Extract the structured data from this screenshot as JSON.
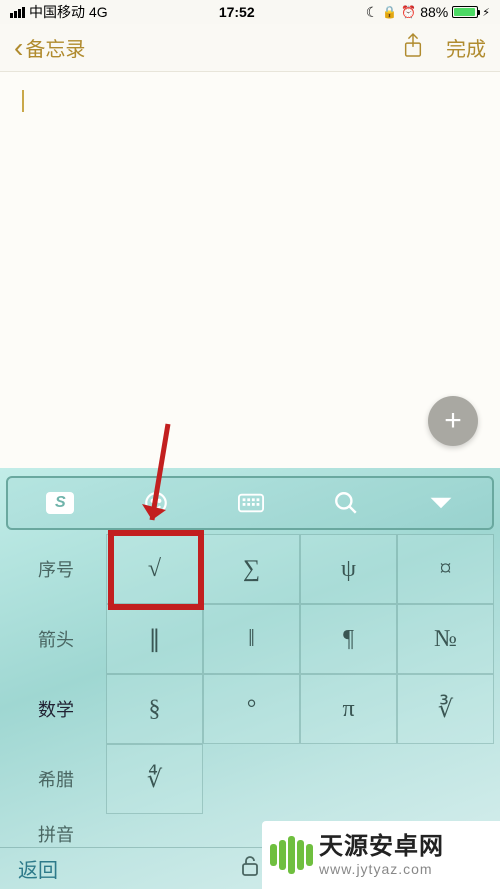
{
  "status": {
    "carrier": "中国移动",
    "network": "4G",
    "time": "17:52",
    "moon": "☾",
    "orientation_lock": "⟳",
    "alarm": "⏰",
    "battery_pct": "88%",
    "charging": "⚡︎"
  },
  "nav": {
    "back_label": "备忘录",
    "done_label": "完成"
  },
  "fab_label": "+",
  "keyboard": {
    "toolbar": {
      "logo": "S"
    },
    "categories": [
      "序号",
      "箭头",
      "数学",
      "希腊",
      "拼音"
    ],
    "grid": [
      [
        "√",
        "∑",
        "ψ",
        "¤"
      ],
      [
        "∥",
        "‖",
        "¶",
        "№"
      ],
      [
        "§",
        "°",
        "π",
        "∛"
      ],
      [
        "∜",
        "",
        "",
        ""
      ]
    ],
    "return_label": "返回"
  },
  "watermark": {
    "title": "天源安卓网",
    "sub": "www.jytyaz.com"
  }
}
